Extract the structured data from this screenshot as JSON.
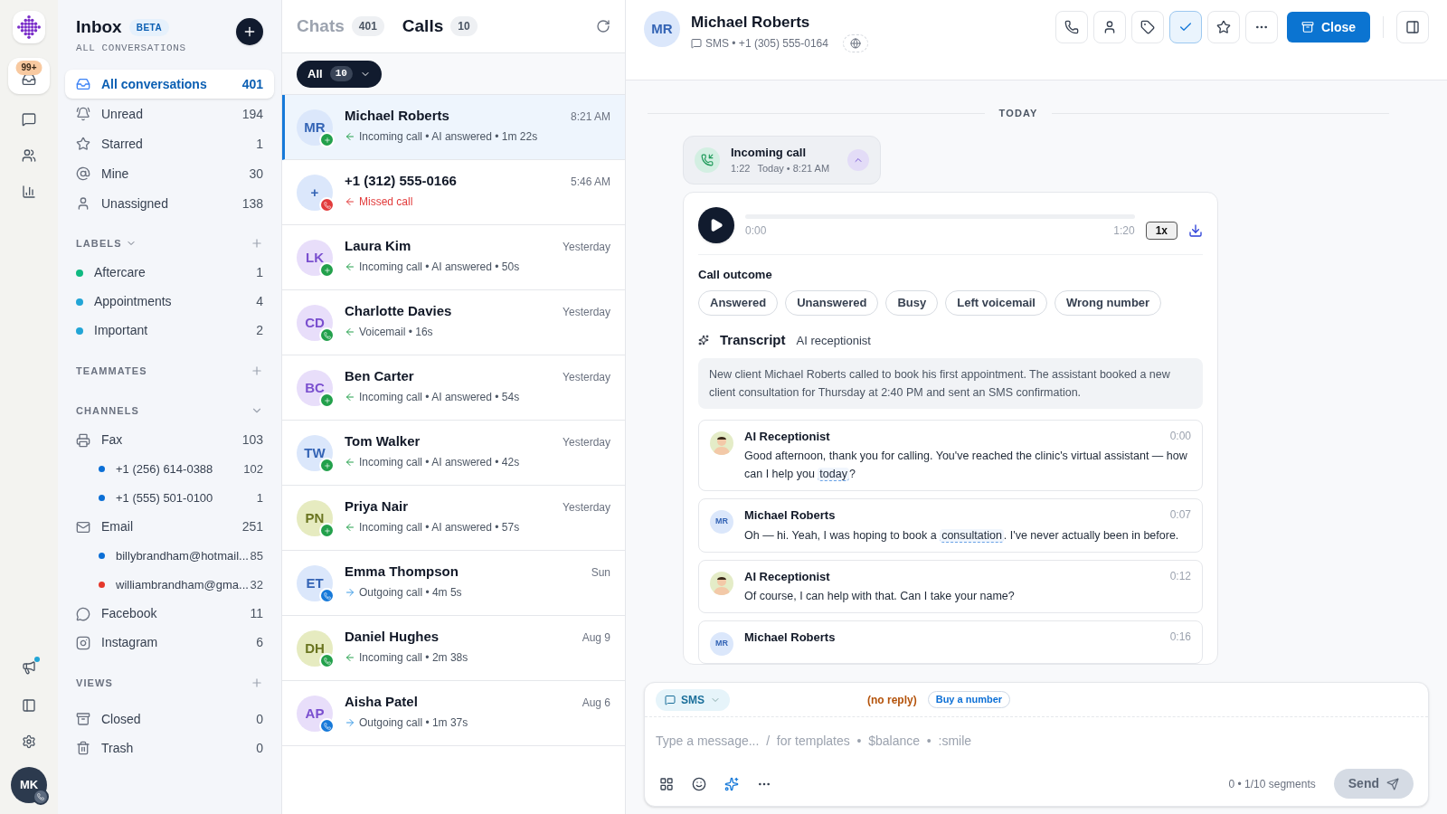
{
  "rail": {
    "inbox_badge": "99+",
    "user_initials": "MK",
    "announcement_unread": true
  },
  "sidebar": {
    "title": "Inbox",
    "badge": "BETA",
    "subtitle": "ALL CONVERSATIONS",
    "items": [
      {
        "kind": "inbox",
        "label": "All conversations",
        "count": "401",
        "selected": true
      },
      {
        "kind": "unread",
        "label": "Unread",
        "count": "194",
        "selected": false
      },
      {
        "kind": "star",
        "label": "Starred",
        "count": "1",
        "selected": false
      },
      {
        "kind": "mine",
        "label": "Mine",
        "count": "30",
        "selected": false
      },
      {
        "kind": "unassigned",
        "label": "Unassigned",
        "count": "138",
        "selected": false
      }
    ],
    "labels_heading": "LABELS",
    "labels": [
      {
        "label": "Aftercare",
        "count": "1",
        "color": "#10b981"
      },
      {
        "label": "Appointments",
        "count": "4",
        "color": "#22a5d6"
      },
      {
        "label": "Important",
        "count": "2",
        "color": "#22a5d6"
      }
    ],
    "teammates_heading": "TEAMMATES",
    "channels_heading": "CHANNELS",
    "channels": [
      {
        "kind": "fax",
        "label": "Fax",
        "count": "103",
        "children": [
          {
            "label": "+1 (256) 614-0388",
            "count": "102",
            "color": "#0b6fd6"
          },
          {
            "label": "+1 (555) 501-0100",
            "count": "1",
            "color": "#0b6fd6"
          }
        ]
      },
      {
        "kind": "email",
        "label": "Email",
        "count": "251",
        "children": [
          {
            "label": "billybrandham@hotmail...",
            "count": "85",
            "color": "#0b6fd6"
          },
          {
            "label": "williambrandham@gma...",
            "count": "32",
            "color": "#e5372b"
          }
        ]
      },
      {
        "kind": "facebook",
        "label": "Facebook",
        "count": "11"
      },
      {
        "kind": "instagram",
        "label": "Instagram",
        "count": "6"
      }
    ],
    "views_heading": "VIEWS",
    "views": [
      {
        "kind": "closed",
        "label": "Closed",
        "count": "0"
      },
      {
        "kind": "trash",
        "label": "Trash",
        "count": "0"
      }
    ]
  },
  "list": {
    "tabs": [
      {
        "label": "Chats",
        "count": "401",
        "selected": false
      },
      {
        "label": "Calls",
        "count": "10",
        "selected": true
      }
    ],
    "filter": {
      "label": "All",
      "count": "10"
    },
    "items": [
      {
        "kind": "ai",
        "initials": "MR",
        "color": "#dbe7fb",
        "name": "Michael Roberts",
        "time": "8:21 AM",
        "status": "Incoming call • AI answered • 1m 22s",
        "selected": true
      },
      {
        "kind": "missed",
        "initials": "+",
        "color": "#dbe7fb",
        "name": "+1 (312) 555-0166",
        "time": "5:46 AM",
        "status": "Missed call",
        "selected": false
      },
      {
        "kind": "ai",
        "initials": "LK",
        "color": "#e8defa",
        "name": "Laura Kim",
        "time": "Yesterday",
        "status": "Incoming call • AI answered • 50s",
        "selected": false
      },
      {
        "kind": "inbound",
        "initials": "CD",
        "color": "#e8defa",
        "name": "Charlotte Davies",
        "time": "Yesterday",
        "status": "Voicemail • 16s",
        "selected": false
      },
      {
        "kind": "ai",
        "initials": "BC",
        "color": "#e8defa",
        "name": "Ben Carter",
        "time": "Yesterday",
        "status": "Incoming call • AI answered • 54s",
        "selected": false
      },
      {
        "kind": "ai",
        "initials": "TW",
        "color": "#dbe7fb",
        "name": "Tom Walker",
        "time": "Yesterday",
        "status": "Incoming call • AI answered • 42s",
        "selected": false
      },
      {
        "kind": "ai",
        "initials": "PN",
        "color": "#e6ebc0",
        "name": "Priya Nair",
        "time": "Yesterday",
        "status": "Incoming call • AI answered • 57s",
        "selected": false
      },
      {
        "kind": "outbound",
        "initials": "ET",
        "color": "#dbe7fb",
        "name": "Emma Thompson",
        "time": "Sun",
        "status": "Outgoing call • 4m 5s",
        "selected": false
      },
      {
        "kind": "inbound",
        "initials": "DH",
        "color": "#e6ebc0",
        "name": "Daniel Hughes",
        "time": "Aug 9",
        "status": "Incoming call • 2m 38s",
        "selected": false
      },
      {
        "kind": "outbound",
        "initials": "AP",
        "color": "#e8defa",
        "name": "Aisha Patel",
        "time": "Aug 6",
        "status": "Outgoing call • 1m 37s",
        "selected": false
      }
    ]
  },
  "conversation": {
    "initials": "MR",
    "name": "Michael Roberts",
    "channel": "SMS • +1 (305) 555-0164",
    "actions": [
      {
        "kind": "phone",
        "selected": false
      },
      {
        "kind": "contact",
        "selected": false
      },
      {
        "kind": "tag",
        "selected": false
      },
      {
        "kind": "check",
        "selected": true
      },
      {
        "kind": "star",
        "selected": false
      },
      {
        "kind": "more",
        "selected": false
      }
    ],
    "close_label": "Close",
    "divider": "TODAY",
    "call": {
      "title": "Incoming call",
      "duration": "1:22",
      "when": "Today • 8:21 AM"
    },
    "player": {
      "level": 0,
      "start": "0:00",
      "end": "1:20",
      "speed": "1x"
    },
    "outcome_heading": "Call outcome",
    "outcomes": [
      "Answered",
      "Unanswered",
      "Busy",
      "Left voicemail",
      "Wrong number"
    ],
    "transcript_title": "Transcript",
    "transcript_source": "AI receptionist",
    "summary": "New client Michael Roberts called to book his first appointment. The assistant booked a new client consultation for Thursday at 2:40 PM and sent an SMS confirmation.",
    "messages": [
      {
        "kind": "ai",
        "speaker": "AI Receptionist",
        "time": "0:00",
        "segments": [
          {
            "text": "Good afternoon, thank you for calling. You've reached the clinic's virtual assistant — how can I help you ",
            "highlighted": false
          },
          {
            "text": "today",
            "highlighted": true
          },
          {
            "text": "?",
            "highlighted": false
          }
        ]
      },
      {
        "kind": "caller",
        "initials": "MR",
        "speaker": "Michael Roberts",
        "time": "0:07",
        "segments": [
          {
            "text": "Oh — hi. Yeah, I was hoping to book a ",
            "highlighted": false
          },
          {
            "text": "consultation",
            "highlighted": true
          },
          {
            "text": ". I've never actually been in before.",
            "highlighted": false
          }
        ]
      },
      {
        "kind": "ai",
        "speaker": "AI Receptionist",
        "time": "0:12",
        "segments": [
          {
            "text": "Of course, I can help with that. Can I take your name?",
            "highlighted": false
          }
        ]
      },
      {
        "kind": "caller",
        "initials": "MR",
        "speaker": "Michael Roberts",
        "time": "0:16"
      }
    ]
  },
  "composer": {
    "channel": "SMS",
    "notice": "(no reply)",
    "buy_label": "Buy a number",
    "placeholder": "Type a message...  /  for templates  •  $balance  •  :smile",
    "counter": "0 • 1/10 segments",
    "send_label": "Send"
  }
}
